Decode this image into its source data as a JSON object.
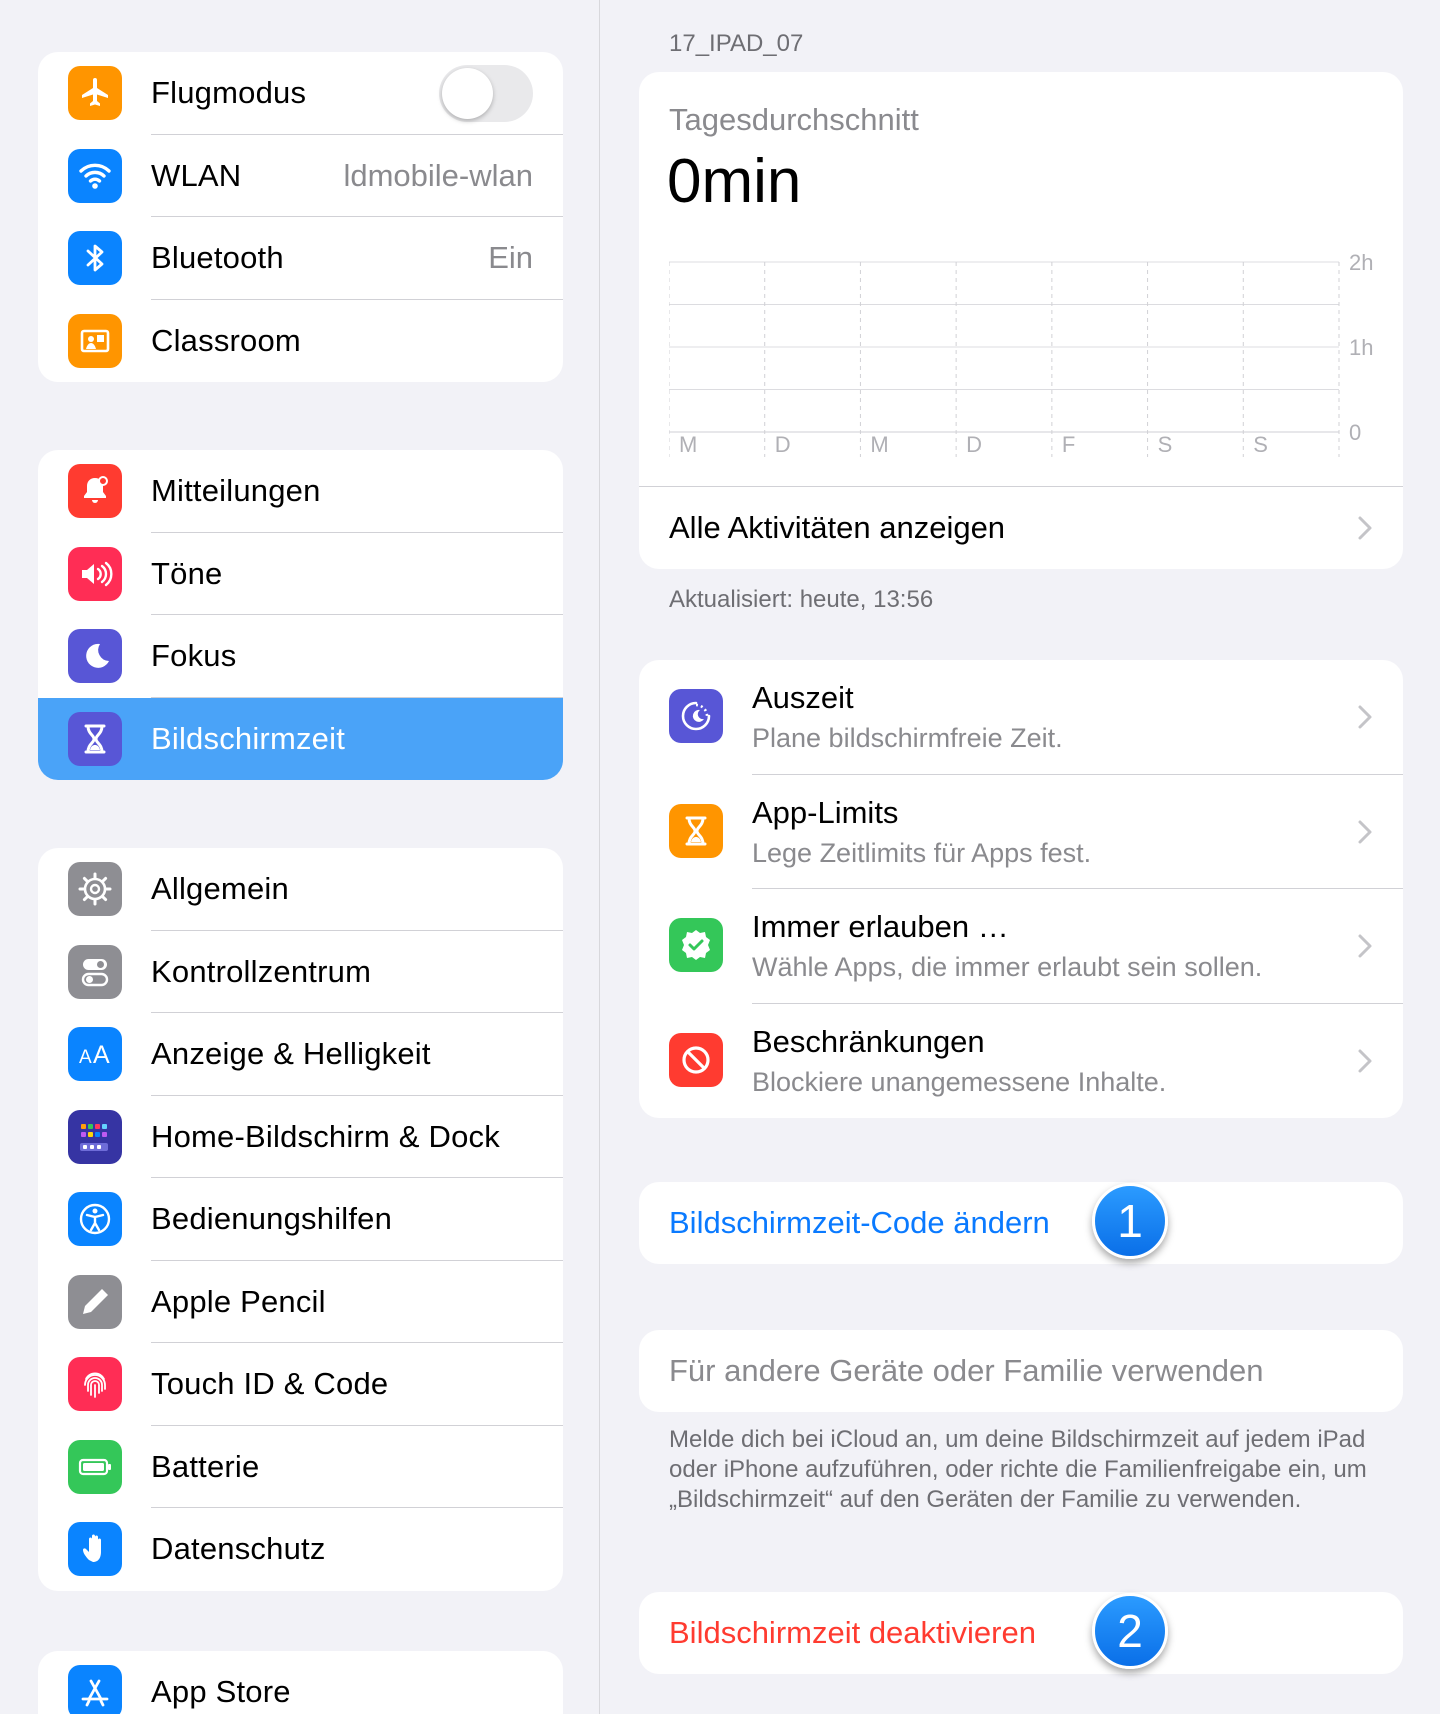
{
  "sidebar": {
    "groups": [
      [
        {
          "label": "Flugmodus",
          "icon": "airplane-icon",
          "color": "#ff9500",
          "toggle": false
        },
        {
          "label": "WLAN",
          "value": "ldmobile-wlan",
          "icon": "wifi-icon",
          "color": "#0a84ff"
        },
        {
          "label": "Bluetooth",
          "value": "Ein",
          "icon": "bluetooth-icon",
          "color": "#0a84ff"
        },
        {
          "label": "Classroom",
          "icon": "classroom-icon",
          "color": "#ff9500"
        }
      ],
      [
        {
          "label": "Mitteilungen",
          "icon": "bell-icon",
          "color": "#ff3b30"
        },
        {
          "label": "Töne",
          "icon": "speaker-icon",
          "color": "#ff2d55"
        },
        {
          "label": "Fokus",
          "icon": "moon-icon",
          "color": "#5856d6"
        },
        {
          "label": "Bildschirmzeit",
          "icon": "hourglass-icon",
          "color": "#5856d6",
          "selected": true
        }
      ],
      [
        {
          "label": "Allgemein",
          "icon": "gear-icon",
          "color": "#8e8e93"
        },
        {
          "label": "Kontrollzentrum",
          "icon": "switches-icon",
          "color": "#8e8e93"
        },
        {
          "label": "Anzeige & Helligkeit",
          "icon": "text-size-icon",
          "color": "#0a84ff"
        },
        {
          "label": "Home-Bildschirm & Dock",
          "icon": "home-grid-icon",
          "color": "#3634a3"
        },
        {
          "label": "Bedienungshilfen",
          "icon": "accessibility-icon",
          "color": "#0a84ff"
        },
        {
          "label": "Apple Pencil",
          "icon": "pencil-icon",
          "color": "#8e8e93"
        },
        {
          "label": "Touch ID & Code",
          "icon": "fingerprint-icon",
          "color": "#ff2d55"
        },
        {
          "label": "Batterie",
          "icon": "battery-icon",
          "color": "#34c759"
        },
        {
          "label": "Datenschutz",
          "icon": "hand-icon",
          "color": "#0a84ff"
        }
      ],
      [
        {
          "label": "App Store",
          "icon": "app-store-icon",
          "color": "#0a84ff"
        }
      ]
    ]
  },
  "main": {
    "device": "17_IPAD_07",
    "average_label": "Tagesdurchschnitt",
    "average_value": "0min",
    "all_activities": "Alle Aktivitäten anzeigen",
    "updated": "Aktualisiert: heute, 13:56",
    "options": [
      {
        "title": "Auszeit",
        "subtitle": "Plane bildschirmfreie Zeit.",
        "icon": "downtime-icon",
        "color": "#5856d6"
      },
      {
        "title": "App-Limits",
        "subtitle": "Lege Zeitlimits für Apps fest.",
        "icon": "hourglass-icon",
        "color": "#ff9500"
      },
      {
        "title": "Immer erlauben …",
        "subtitle": "Wähle Apps, die immer erlaubt sein sollen.",
        "icon": "checkmark-seal-icon",
        "color": "#34c759"
      },
      {
        "title": "Beschränkungen",
        "subtitle": "Blockiere unangemessene Inhalte.",
        "icon": "no-entry-icon",
        "color": "#ff3b30"
      }
    ],
    "change_code": "Bildschirmzeit-Code ändern",
    "badge1": "1",
    "family": "Für andere Geräte oder Familie verwenden",
    "footnote": "Melde dich bei iCloud an, um deine Bildschirmzeit auf jedem iPad oder iPhone aufzuführen, oder richte die Familienfreigabe ein, um „Bildschirmzeit“ auf den Geräten der Familie zu verwenden.",
    "deactivate": "Bildschirmzeit deaktivieren",
    "badge2": "2",
    "colors": {
      "link": "#0a7aff",
      "destructive": "#ff3b30",
      "disabled": "#8a8a8e"
    }
  },
  "chart_data": {
    "type": "bar",
    "categories": [
      "M",
      "D",
      "M",
      "D",
      "F",
      "S",
      "S"
    ],
    "values": [
      0,
      0,
      0,
      0,
      0,
      0,
      0
    ],
    "y_ticks": [
      "2h",
      "1h",
      "0"
    ],
    "ylim": [
      0,
      2
    ]
  }
}
